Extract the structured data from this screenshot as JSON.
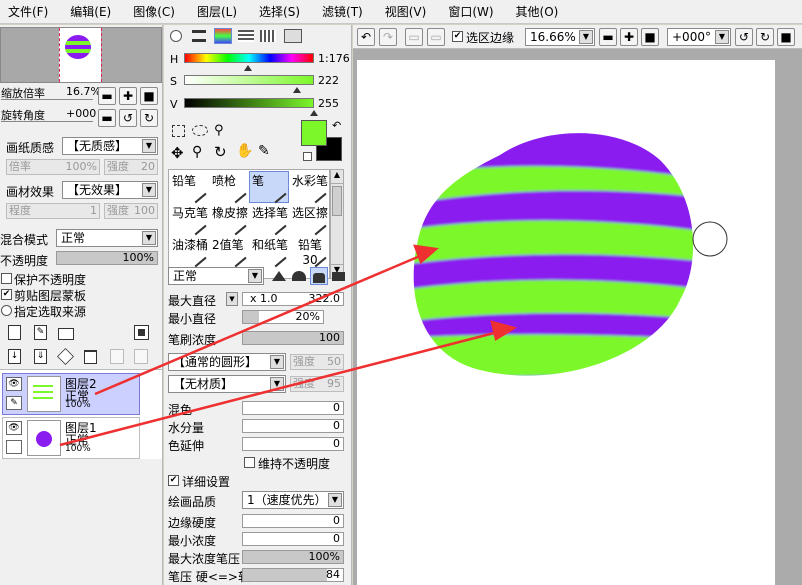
{
  "menu": [
    "文件(F)",
    "编辑(E)",
    "图像(C)",
    "图层(L)",
    "选择(S)",
    "滤镜(T)",
    "视图(V)",
    "窗口(W)",
    "其他(O)"
  ],
  "navigator": {
    "zoom_label": "缩放倍率",
    "zoom_value": "16.7%",
    "rotate_label": "旋转角度",
    "rotate_value": "+000"
  },
  "paper": {
    "texture_label": "画纸质感",
    "texture_value": "【无质感】",
    "rate_label": "倍率",
    "rate_value": "100%",
    "strength_label": "强度",
    "strength_value": "20",
    "effect_label": "画材效果",
    "effect_value": "【无效果】",
    "degree_label": "程度",
    "degree_value": "1",
    "strength2_label": "强度",
    "strength2_value": "100"
  },
  "layer_props": {
    "blend_label": "混合模式",
    "blend_value": "正常",
    "opacity_label": "不透明度",
    "opacity_value": "100%",
    "protect_label": "保护不透明度",
    "clip_label": "剪贴图层蒙板",
    "source_label": "指定选取来源"
  },
  "layers": [
    {
      "name": "图层2",
      "mode": "正常",
      "opacity": "100%"
    },
    {
      "name": "图层1",
      "mode": "正常",
      "opacity": "100%"
    }
  ],
  "color": {
    "h_label": "H",
    "h_value": "1:176",
    "s_label": "S",
    "s_value": "222",
    "v_label": "V",
    "v_value": "255",
    "fg": "#7cf72a",
    "bg": "#000000",
    "h_pos": 0.49,
    "s_pos": 0.87,
    "v_pos": 1.0
  },
  "brushes": [
    [
      "铅笔",
      "喷枪",
      "笔",
      "水彩笔"
    ],
    [
      "马克笔",
      "橡皮擦",
      "选择笔",
      "选区擦"
    ],
    [
      "油漆桶",
      "2值笔",
      "和纸笔",
      "铅笔30"
    ]
  ],
  "brush_settings": {
    "shape_value": "正常",
    "max_diameter_label": "最大直径",
    "max_diameter_mult": "x 1.0",
    "max_diameter_value": "322.0",
    "min_diameter_label": "最小直径",
    "min_diameter_value": "20%",
    "min_diameter_pos": 0.2,
    "density_label": "笔刷浓度",
    "density_value": "100",
    "density_pos": 1.0,
    "shape_dd": "【通常的圆形】",
    "shape_strength_label": "强度",
    "shape_strength_value": "50",
    "texture_dd": "【无材质】",
    "texture_strength_label": "强度",
    "texture_strength_value": "95",
    "blend_label": "混色",
    "blend_value": "0",
    "water_label": "水分量",
    "water_value": "0",
    "extend_label": "色延伸",
    "extend_value": "0",
    "keep_opacity_label": "维持不透明度",
    "detail_label": "详细设置",
    "quality_label": "绘画品质",
    "quality_value": "1（速度优先）",
    "edge_label": "边缘硬度",
    "edge_value": "0",
    "min_density_label": "最小浓度",
    "min_density_value": "0",
    "max_pressure_label": "最大浓度笔压",
    "max_pressure_value": "100%",
    "max_pressure_pos": 1.0,
    "pressure_label": "笔压 硬<=>软",
    "pressure_value": "84",
    "pressure_pos": 0.84
  },
  "canvas_toolbar": {
    "selection_edge_label": "选区边缘",
    "zoom_value": "16.66%",
    "rotate_value": "+000°"
  },
  "stripe_colors": {
    "purple": "#8a1cf0",
    "green": "#7cf72a"
  }
}
